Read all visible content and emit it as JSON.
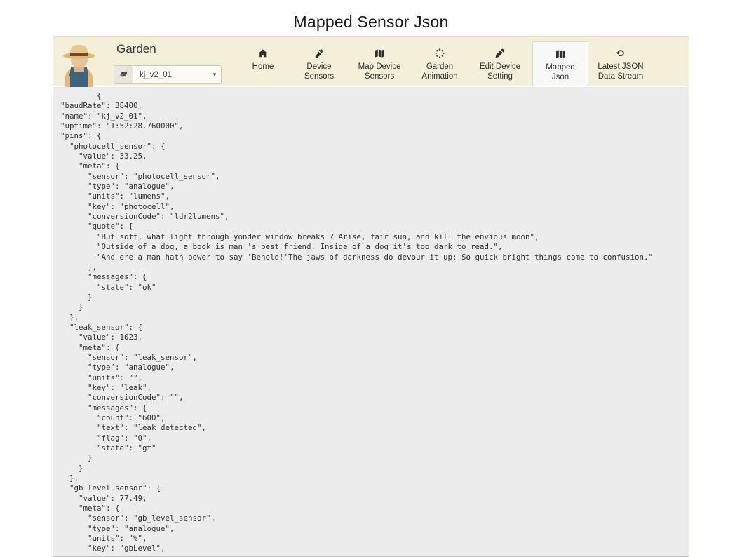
{
  "page": {
    "title": "Mapped Sensor Json"
  },
  "navbar": {
    "brand": "Garden",
    "avatar_icon": "farmer-avatar-icon",
    "device_picker": {
      "leaf_icon": "leaf-icon",
      "selected_device": "kj_v2_01",
      "caret_icon": "chevron-down-icon"
    },
    "items": [
      {
        "label": "Home",
        "icon": "home-icon",
        "active": false
      },
      {
        "label": "Device\nSensors",
        "icon": "plug-icon",
        "active": false
      },
      {
        "label": "Map Device\nSensors",
        "icon": "map-icon",
        "active": false
      },
      {
        "label": "Garden\nAnimation",
        "icon": "spinner-icon",
        "active": false
      },
      {
        "label": "Edit Device\nSetting",
        "icon": "pencil-icon",
        "active": false
      },
      {
        "label": "Mapped\nJson",
        "icon": "map-icon",
        "active": true
      },
      {
        "label": "Latest JSON\nData Stream",
        "icon": "undo-icon",
        "active": false
      }
    ]
  },
  "json_view": {
    "content": "        {\n\"baudRate\": 38400,\n\"name\": \"kj_v2_01\",\n\"uptime\": \"1:52:28.760000\",\n\"pins\": {\n  \"photocell_sensor\": {\n    \"value\": 33.25,\n    \"meta\": {\n      \"sensor\": \"photocell_sensor\",\n      \"type\": \"analogue\",\n      \"units\": \"lumens\",\n      \"key\": \"photocell\",\n      \"conversionCode\": \"ldr2lumens\",\n      \"quote\": [\n        \"But soft, what light through yonder window breaks ? Arise, fair sun, and kill the envious moon\",\n        \"Outside of a dog, a book is man 's best friend. Inside of a dog it's too dark to read.\",\n        \"And ere a man hath power to say 'Behold!'The jaws of darkness do devour it up: So quick bright things come to confusion.\"\n      ],\n      \"messages\": {\n        \"state\": \"ok\"\n      }\n    }\n  },\n  \"leak_sensor\": {\n    \"value\": 1023,\n    \"meta\": {\n      \"sensor\": \"leak_sensor\",\n      \"type\": \"analogue\",\n      \"units\": \"\",\n      \"key\": \"leak\",\n      \"conversionCode\": \"\",\n      \"messages\": {\n        \"count\": \"600\",\n        \"text\": \"leak detected\",\n        \"flag\": \"0\",\n        \"state\": \"gt\"\n      }\n    }\n  },\n  \"gb_level_sensor\": {\n    \"value\": 77.49,\n    \"meta\": {\n      \"sensor\": \"gb_level_sensor\",\n      \"type\": \"analogue\",\n      \"units\": \"%\",\n      \"key\": \"gbLevel\","
  }
}
